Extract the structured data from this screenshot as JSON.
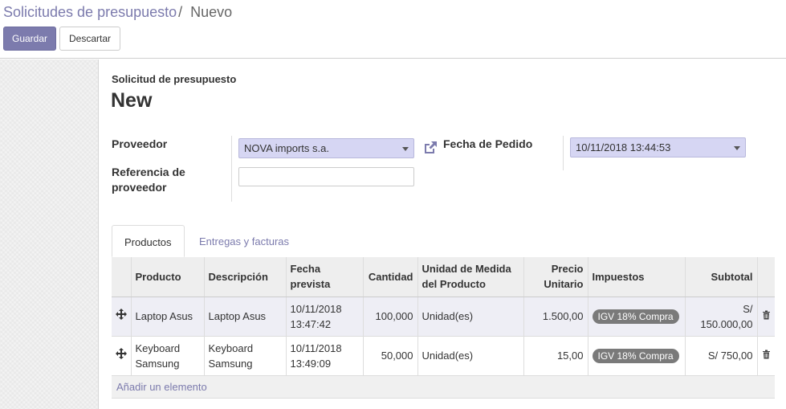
{
  "breadcrumb": {
    "parent": "Solicitudes de presupuesto",
    "separator": "/",
    "current": "Nuevo"
  },
  "buttons": {
    "save": "Guardar",
    "discard": "Descartar"
  },
  "sheet": {
    "doc_label": "Solicitud de presupuesto",
    "doc_title": "New",
    "proveedor_label": "Proveedor",
    "proveedor_value": "NOVA imports s.a.",
    "referencia_label": "Referencia de proveedor",
    "referencia_value": "",
    "fecha_label": "Fecha de Pedido",
    "fecha_value": "10/11/2018 13:44:53"
  },
  "tabs": [
    {
      "label": "Productos",
      "active": true
    },
    {
      "label": "Entregas y facturas",
      "active": false
    }
  ],
  "table": {
    "headers": [
      "Producto",
      "Descripción",
      "Fecha prevista",
      "Cantidad",
      "Unidad de Medida del Producto",
      "Precio Unitario",
      "Impuestos",
      "Subtotal"
    ],
    "rows": [
      {
        "producto": "Laptop Asus",
        "descripcion": "Laptop Asus",
        "fecha": "10/11/2018 13:47:42",
        "cantidad": "100,000",
        "unidad": "Unidad(es)",
        "precio": "1.500,00",
        "impuesto": "IGV 18% Compra",
        "subtotal": "S/ 150.000,00"
      },
      {
        "producto": "Keyboard Samsung",
        "descripcion": "Keyboard Samsung",
        "fecha": "10/11/2018 13:49:09",
        "cantidad": "50,000",
        "unidad": "Unidad(es)",
        "precio": "15,00",
        "impuesto": "IGV 18% Compra",
        "subtotal": "S/ 750,00"
      }
    ],
    "add_line": "Añadir un elemento"
  },
  "icons": {
    "move": "move-handle-icon",
    "trash": "trash-icon",
    "external": "external-link-icon",
    "caret": "caret-down-icon"
  },
  "colors": {
    "primary": "#7c7bad",
    "required_field": "#d6d6f3",
    "badge": "#7a7a7a"
  }
}
